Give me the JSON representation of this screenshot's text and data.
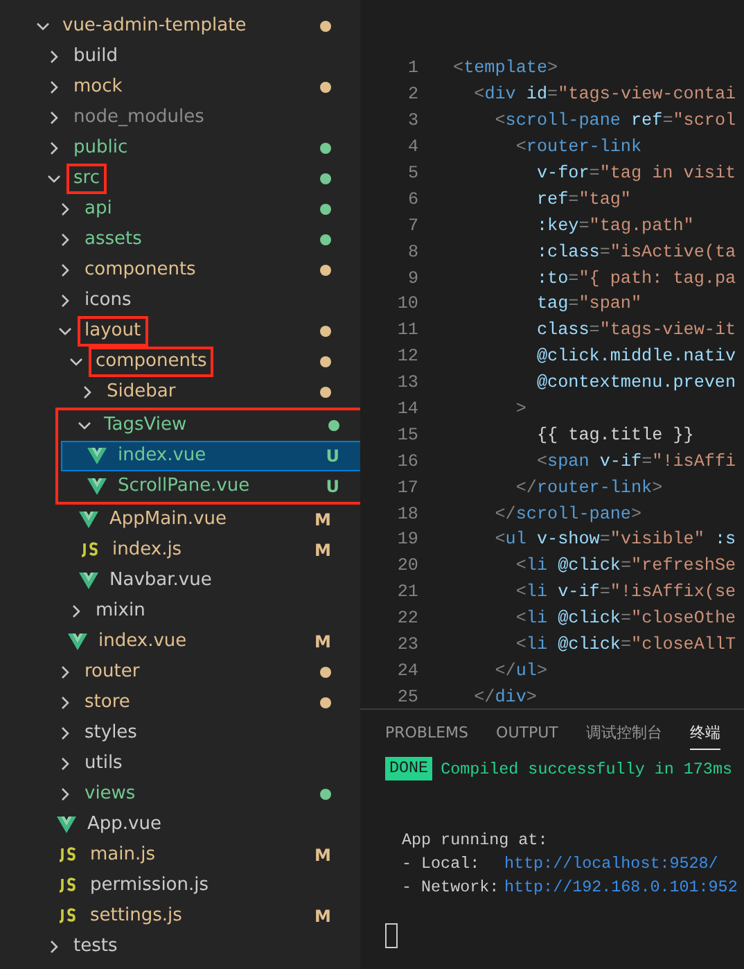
{
  "explorer": {
    "tree": [
      {
        "name": "vue-admin-template",
        "kind": "folder",
        "expanded": true,
        "color": "#e2c08d",
        "dot": true,
        "children": [
          {
            "name": "build",
            "kind": "folder",
            "expanded": false,
            "color": "#cccccc",
            "dot": false
          },
          {
            "name": "mock",
            "kind": "folder",
            "expanded": false,
            "color": "#e2c08d",
            "dot": true
          },
          {
            "name": "node_modules",
            "kind": "folder",
            "expanded": false,
            "color": "#8c8c8c",
            "dot": false
          },
          {
            "name": "public",
            "kind": "folder",
            "expanded": false,
            "color": "#73c991",
            "dot": true
          },
          {
            "name": "src",
            "kind": "folder",
            "expanded": true,
            "color": "#73c991",
            "dot": true,
            "highlighted": true,
            "children": [
              {
                "name": "api",
                "kind": "folder",
                "expanded": false,
                "color": "#73c991",
                "dot": true
              },
              {
                "name": "assets",
                "kind": "folder",
                "expanded": false,
                "color": "#73c991",
                "dot": true
              },
              {
                "name": "components",
                "kind": "folder",
                "expanded": false,
                "color": "#e2c08d",
                "dot": true
              },
              {
                "name": "icons",
                "kind": "folder",
                "expanded": false,
                "color": "#cccccc",
                "dot": false
              },
              {
                "name": "layout",
                "kind": "folder",
                "expanded": true,
                "color": "#e2c08d",
                "dot": true,
                "highlighted": true,
                "children": [
                  {
                    "name": "components",
                    "kind": "folder",
                    "expanded": true,
                    "color": "#e2c08d",
                    "dot": true,
                    "highlighted": true,
                    "children": [
                      {
                        "name": "Sidebar",
                        "kind": "folder",
                        "expanded": false,
                        "color": "#e2c08d",
                        "dot": true
                      },
                      {
                        "name": "TagsView",
                        "kind": "folder",
                        "expanded": true,
                        "color": "#73c991",
                        "dot": true,
                        "highlighted": true,
                        "children": [
                          {
                            "name": "index.vue",
                            "kind": "vue",
                            "color": "#73c991",
                            "badge": "U",
                            "selected": true
                          },
                          {
                            "name": "ScrollPane.vue",
                            "kind": "vue",
                            "color": "#73c991",
                            "badge": "U",
                            "selected": false
                          }
                        ]
                      },
                      {
                        "name": "AppMain.vue",
                        "kind": "vue",
                        "color": "#e2c08d",
                        "badge": "M",
                        "selected": false
                      },
                      {
                        "name": "index.js",
                        "kind": "js",
                        "color": "#e2c08d",
                        "badge": "M",
                        "selected": false
                      },
                      {
                        "name": "Navbar.vue",
                        "kind": "vue",
                        "color": "#cccccc",
                        "selected": false
                      }
                    ]
                  },
                  {
                    "name": "mixin",
                    "kind": "folder",
                    "expanded": false,
                    "color": "#cccccc",
                    "dot": false
                  },
                  {
                    "name": "index.vue",
                    "kind": "vue",
                    "color": "#e2c08d",
                    "badge": "M",
                    "selected": false
                  }
                ]
              },
              {
                "name": "router",
                "kind": "folder",
                "expanded": false,
                "color": "#e2c08d",
                "dot": true
              },
              {
                "name": "store",
                "kind": "folder",
                "expanded": false,
                "color": "#e2c08d",
                "dot": true
              },
              {
                "name": "styles",
                "kind": "folder",
                "expanded": false,
                "color": "#cccccc",
                "dot": false
              },
              {
                "name": "utils",
                "kind": "folder",
                "expanded": false,
                "color": "#cccccc",
                "dot": false
              },
              {
                "name": "views",
                "kind": "folder",
                "expanded": false,
                "color": "#73c991",
                "dot": true
              },
              {
                "name": "App.vue",
                "kind": "vue",
                "color": "#cccccc",
                "selected": false
              },
              {
                "name": "main.js",
                "kind": "js",
                "color": "#e2c08d",
                "badge": "M",
                "selected": false
              },
              {
                "name": "permission.js",
                "kind": "js",
                "color": "#cccccc",
                "selected": false
              },
              {
                "name": "settings.js",
                "kind": "js",
                "color": "#e2c08d",
                "badge": "M",
                "selected": false
              }
            ]
          },
          {
            "name": "tests",
            "kind": "folder",
            "expanded": false,
            "color": "#cccccc",
            "dot": false
          }
        ]
      }
    ]
  },
  "editor": {
    "lines": [
      {
        "number": "1",
        "tokens": [
          {
            "kind": "punct",
            "text": "<"
          },
          {
            "kind": "tag",
            "text": "template"
          },
          {
            "kind": "punct",
            "text": ">"
          }
        ]
      },
      {
        "number": "2",
        "tokens": [
          {
            "kind": "punct",
            "text": "  <"
          },
          {
            "kind": "tag",
            "text": "div "
          },
          {
            "kind": "attr",
            "text": "id"
          },
          {
            "kind": "punct",
            "text": "="
          },
          {
            "kind": "string",
            "text": "\"tags-view-contai"
          }
        ]
      },
      {
        "number": "3",
        "tokens": [
          {
            "kind": "punct",
            "text": "    <"
          },
          {
            "kind": "tag",
            "text": "scroll-pane "
          },
          {
            "kind": "attr",
            "text": "ref"
          },
          {
            "kind": "punct",
            "text": "="
          },
          {
            "kind": "string",
            "text": "\"scrol"
          }
        ]
      },
      {
        "number": "4",
        "tokens": [
          {
            "kind": "punct",
            "text": "      <"
          },
          {
            "kind": "tag",
            "text": "router-link"
          }
        ]
      },
      {
        "number": "5",
        "tokens": [
          {
            "kind": "attr",
            "text": "        v-for"
          },
          {
            "kind": "punct",
            "text": "="
          },
          {
            "kind": "string",
            "text": "\"tag in visit"
          }
        ]
      },
      {
        "number": "6",
        "tokens": [
          {
            "kind": "attr",
            "text": "        ref"
          },
          {
            "kind": "punct",
            "text": "="
          },
          {
            "kind": "string",
            "text": "\"tag\""
          }
        ]
      },
      {
        "number": "7",
        "tokens": [
          {
            "kind": "attr",
            "text": "        :key"
          },
          {
            "kind": "punct",
            "text": "="
          },
          {
            "kind": "string",
            "text": "\"tag.path\""
          }
        ]
      },
      {
        "number": "8",
        "tokens": [
          {
            "kind": "attr",
            "text": "        :class"
          },
          {
            "kind": "punct",
            "text": "="
          },
          {
            "kind": "string",
            "text": "\"isActive(ta"
          }
        ]
      },
      {
        "number": "9",
        "tokens": [
          {
            "kind": "attr",
            "text": "        :to"
          },
          {
            "kind": "punct",
            "text": "="
          },
          {
            "kind": "string",
            "text": "\"{ path: tag.pa"
          }
        ]
      },
      {
        "number": "10",
        "tokens": [
          {
            "kind": "attr",
            "text": "        tag"
          },
          {
            "kind": "punct",
            "text": "="
          },
          {
            "kind": "string",
            "text": "\"span\""
          }
        ]
      },
      {
        "number": "11",
        "tokens": [
          {
            "kind": "attr",
            "text": "        class"
          },
          {
            "kind": "punct",
            "text": "="
          },
          {
            "kind": "string",
            "text": "\"tags-view-it"
          }
        ]
      },
      {
        "number": "12",
        "tokens": [
          {
            "kind": "attr",
            "text": "        @click.middle.nativ"
          }
        ]
      },
      {
        "number": "13",
        "tokens": [
          {
            "kind": "attr",
            "text": "        @contextmenu.preven"
          }
        ]
      },
      {
        "number": "14",
        "tokens": [
          {
            "kind": "punct",
            "text": "      >"
          }
        ]
      },
      {
        "number": "15",
        "tokens": [
          {
            "kind": "plain",
            "text": "        {{ tag.title }}"
          }
        ]
      },
      {
        "number": "16",
        "tokens": [
          {
            "kind": "punct",
            "text": "        <"
          },
          {
            "kind": "tag",
            "text": "span "
          },
          {
            "kind": "attr",
            "text": "v-if"
          },
          {
            "kind": "punct",
            "text": "="
          },
          {
            "kind": "string",
            "text": "\"!isAffi"
          }
        ]
      },
      {
        "number": "17",
        "tokens": [
          {
            "kind": "punct",
            "text": "      </"
          },
          {
            "kind": "tag",
            "text": "router-link"
          },
          {
            "kind": "punct",
            "text": ">"
          }
        ]
      },
      {
        "number": "18",
        "tokens": [
          {
            "kind": "punct",
            "text": "    </"
          },
          {
            "kind": "tag",
            "text": "scroll-pane"
          },
          {
            "kind": "punct",
            "text": ">"
          }
        ]
      },
      {
        "number": "19",
        "tokens": [
          {
            "kind": "punct",
            "text": "    <"
          },
          {
            "kind": "tag",
            "text": "ul "
          },
          {
            "kind": "attr",
            "text": "v-show"
          },
          {
            "kind": "punct",
            "text": "="
          },
          {
            "kind": "string",
            "text": "\"visible\" "
          },
          {
            "kind": "attr",
            "text": ":s"
          }
        ]
      },
      {
        "number": "20",
        "tokens": [
          {
            "kind": "punct",
            "text": "      <"
          },
          {
            "kind": "tag",
            "text": "li "
          },
          {
            "kind": "attr",
            "text": "@click"
          },
          {
            "kind": "punct",
            "text": "="
          },
          {
            "kind": "string",
            "text": "\"refreshSe"
          }
        ]
      },
      {
        "number": "21",
        "tokens": [
          {
            "kind": "punct",
            "text": "      <"
          },
          {
            "kind": "tag",
            "text": "li "
          },
          {
            "kind": "attr",
            "text": "v-if"
          },
          {
            "kind": "punct",
            "text": "="
          },
          {
            "kind": "string",
            "text": "\"!isAffix(se"
          }
        ]
      },
      {
        "number": "22",
        "tokens": [
          {
            "kind": "punct",
            "text": "      <"
          },
          {
            "kind": "tag",
            "text": "li "
          },
          {
            "kind": "attr",
            "text": "@click"
          },
          {
            "kind": "punct",
            "text": "="
          },
          {
            "kind": "string",
            "text": "\"closeOthe"
          }
        ]
      },
      {
        "number": "23",
        "tokens": [
          {
            "kind": "punct",
            "text": "      <"
          },
          {
            "kind": "tag",
            "text": "li "
          },
          {
            "kind": "attr",
            "text": "@click"
          },
          {
            "kind": "punct",
            "text": "="
          },
          {
            "kind": "string",
            "text": "\"closeAllT"
          }
        ]
      },
      {
        "number": "24",
        "tokens": [
          {
            "kind": "punct",
            "text": "    </"
          },
          {
            "kind": "tag",
            "text": "ul"
          },
          {
            "kind": "punct",
            "text": ">"
          }
        ]
      },
      {
        "number": "25",
        "tokens": [
          {
            "kind": "punct",
            "text": "  </"
          },
          {
            "kind": "tag",
            "text": "div"
          },
          {
            "kind": "punct",
            "text": ">"
          }
        ]
      }
    ]
  },
  "panel": {
    "tabs": [
      {
        "label": "PROBLEMS",
        "selected": false
      },
      {
        "label": "OUTPUT",
        "selected": false
      },
      {
        "label": "调试控制台",
        "selected": false
      },
      {
        "label": "终端",
        "selected": true
      }
    ],
    "terminal": {
      "badge": "DONE",
      "message": "Compiled successfully in 173ms",
      "running": "App running at:",
      "urls": [
        {
          "label": "- Local:",
          "url": "http://localhost:9528/"
        },
        {
          "label": "- Network:",
          "url": "http://192.168.0.101:952"
        }
      ]
    }
  }
}
